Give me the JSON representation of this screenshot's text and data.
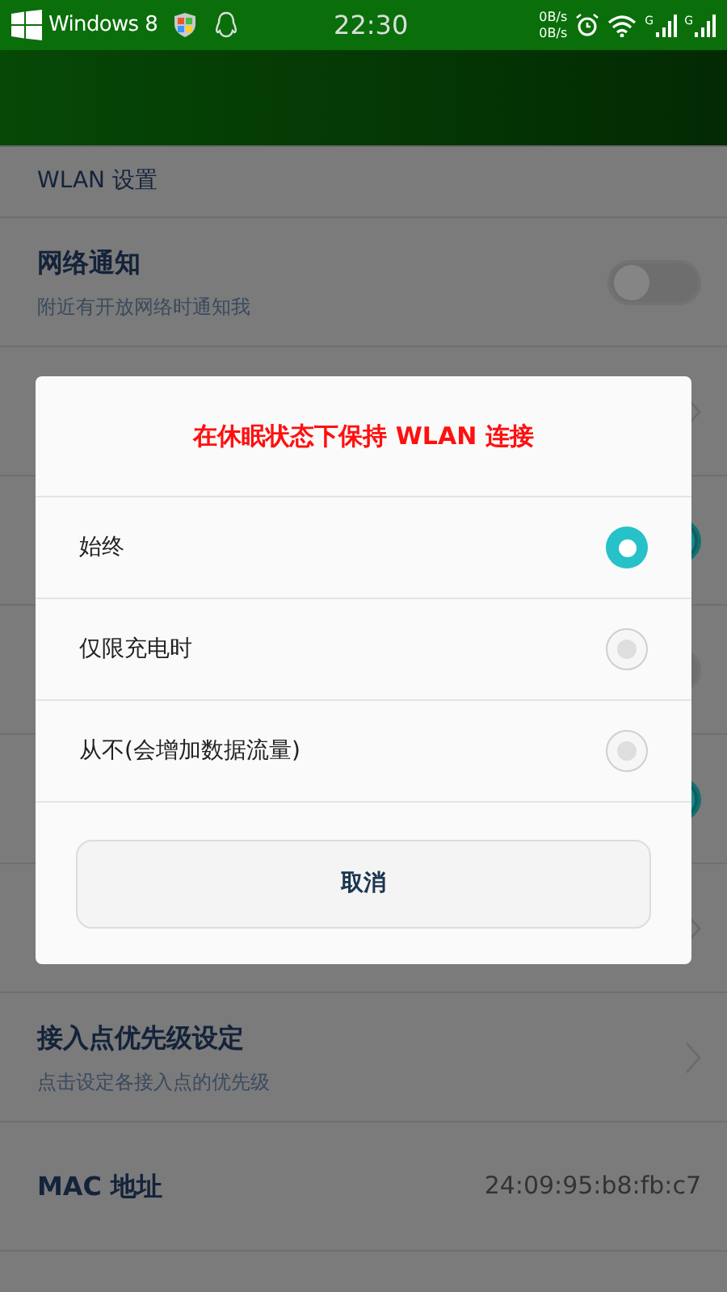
{
  "status_bar": {
    "carrier": "Windows 8",
    "time": "22:30",
    "speed_up": "0B/s",
    "speed_down": "0B/s",
    "signals": [
      {
        "label": "G"
      },
      {
        "label": "G"
      }
    ]
  },
  "section_title": "WLAN 设置",
  "rows": [
    {
      "kind": "toggle",
      "title": "网络通知",
      "subtitle": "附近有开放网络时通知我",
      "on": false
    },
    {
      "kind": "hidden_chevron"
    },
    {
      "kind": "hidden_toggle",
      "on": true
    },
    {
      "kind": "hidden_toggle",
      "on": false
    },
    {
      "kind": "hidden_toggle",
      "on": true
    },
    {
      "kind": "hidden_chevron"
    },
    {
      "kind": "chevron",
      "title": "接入点优先级设定",
      "subtitle": "点击设定各接入点的优先级"
    },
    {
      "kind": "value",
      "title": "MAC 地址",
      "value": "24:09:95:b8:fb:c7"
    }
  ],
  "dialog": {
    "title": "在休眠状态下保持 WLAN 连接",
    "options": [
      {
        "label": "始终",
        "selected": true
      },
      {
        "label": "仅限充电时",
        "selected": false
      },
      {
        "label": "从不(会增加数据流量)",
        "selected": false
      }
    ],
    "cancel": "取消"
  }
}
